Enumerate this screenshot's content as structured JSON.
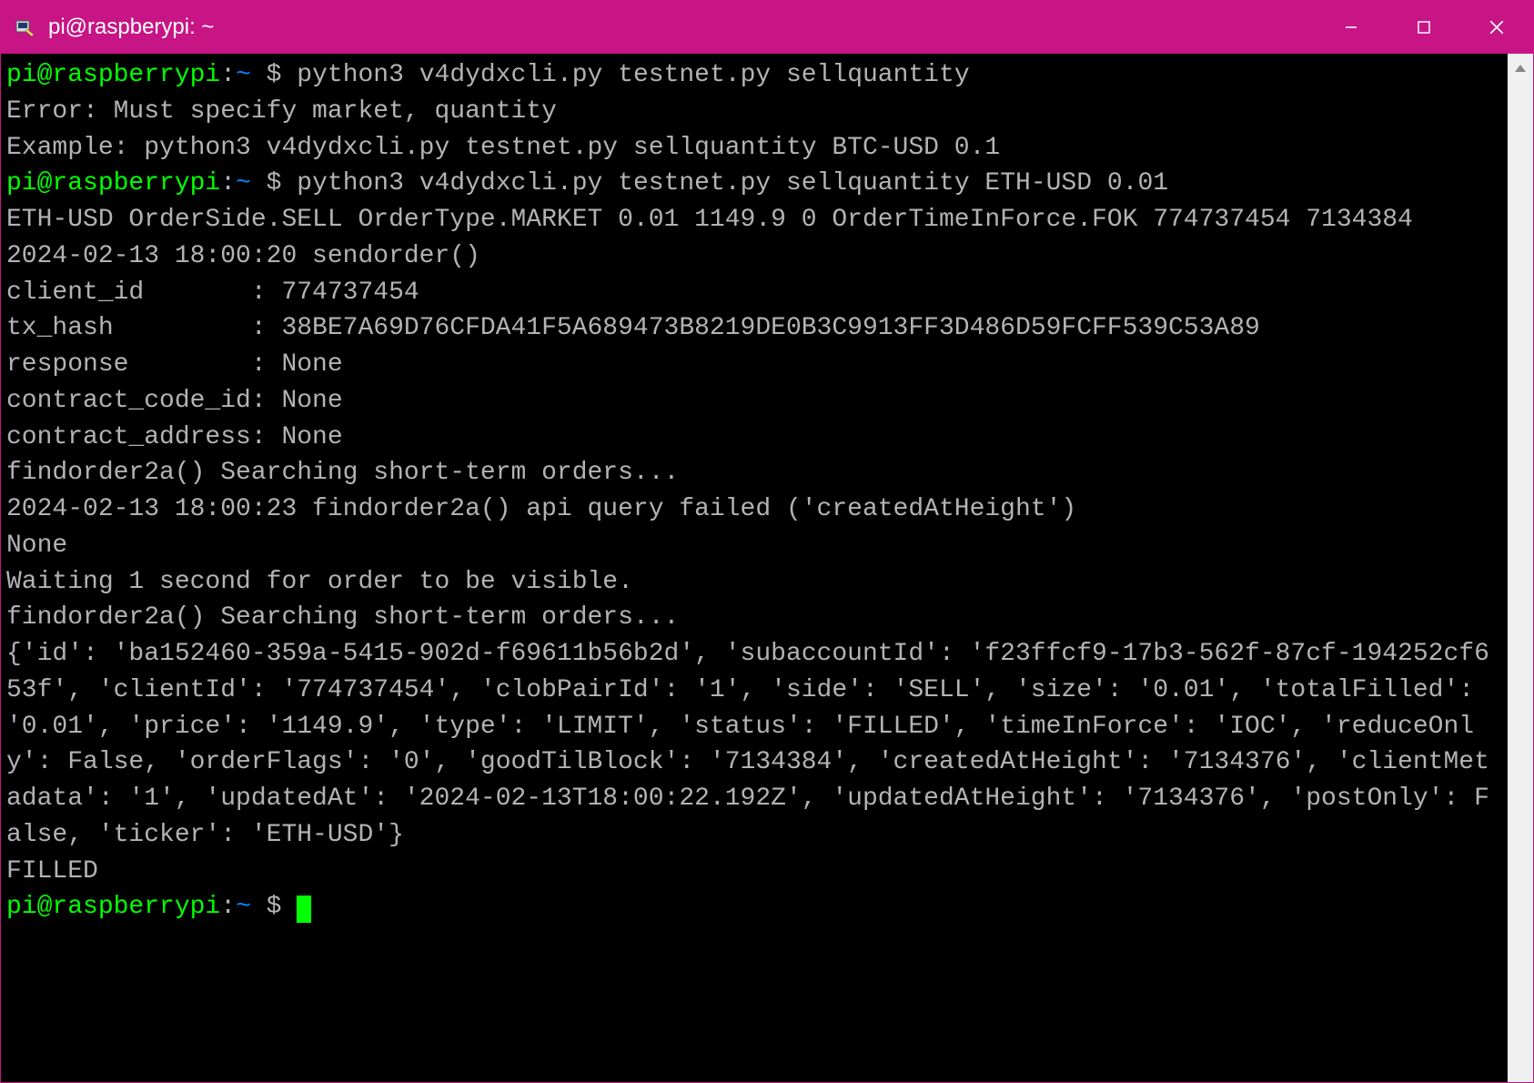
{
  "window": {
    "title": "pi@raspberypi: ~"
  },
  "prompt": {
    "user_host": "pi@raspberrypi",
    "separator": ":",
    "path": "~",
    "dollar": " $ "
  },
  "commands": {
    "cmd1": "python3 v4dydxcli.py testnet.py sellquantity",
    "cmd2": "python3 v4dydxcli.py testnet.py sellquantity ETH-USD 0.01"
  },
  "output": {
    "err1": "Error: Must specify market, quantity",
    "err2": "Example: python3 v4dydxcli.py testnet.py sellquantity BTC-USD 0.1",
    "line1": "ETH-USD OrderSide.SELL OrderType.MARKET 0.01 1149.9 0 OrderTimeInForce.FOK 774737454 7134384",
    "line2": "2024-02-13 18:00:20 sendorder()",
    "line3": "client_id       : 774737454",
    "line4": "tx_hash         : 38BE7A69D76CFDA41F5A689473B8219DE0B3C9913FF3D486D59FCFF539C53A89",
    "line5": "response        : None",
    "line6": "contract_code_id: None",
    "line7": "contract_address: None",
    "line8": "findorder2a() Searching short-term orders...",
    "line9": "2024-02-13 18:00:23 findorder2a() api query failed ('createdAtHeight')",
    "line10": "None",
    "line11": "Waiting 1 second for order to be visible.",
    "line12": "findorder2a() Searching short-term orders...",
    "line13": "{'id': 'ba152460-359a-5415-902d-f69611b56b2d', 'subaccountId': 'f23ffcf9-17b3-562f-87cf-194252cf653f', 'clientId': '774737454', 'clobPairId': '1', 'side': 'SELL', 'size': '0.01', 'totalFilled': '0.01', 'price': '1149.9', 'type': 'LIMIT', 'status': 'FILLED', 'timeInForce': 'IOC', 'reduceOnly': False, 'orderFlags': '0', 'goodTilBlock': '7134384', 'createdAtHeight': '7134376', 'clientMetadata': '1', 'updatedAt': '2024-02-13T18:00:22.192Z', 'updatedAtHeight': '7134376', 'postOnly': False, 'ticker': 'ETH-USD'}",
    "line14": "FILLED"
  }
}
